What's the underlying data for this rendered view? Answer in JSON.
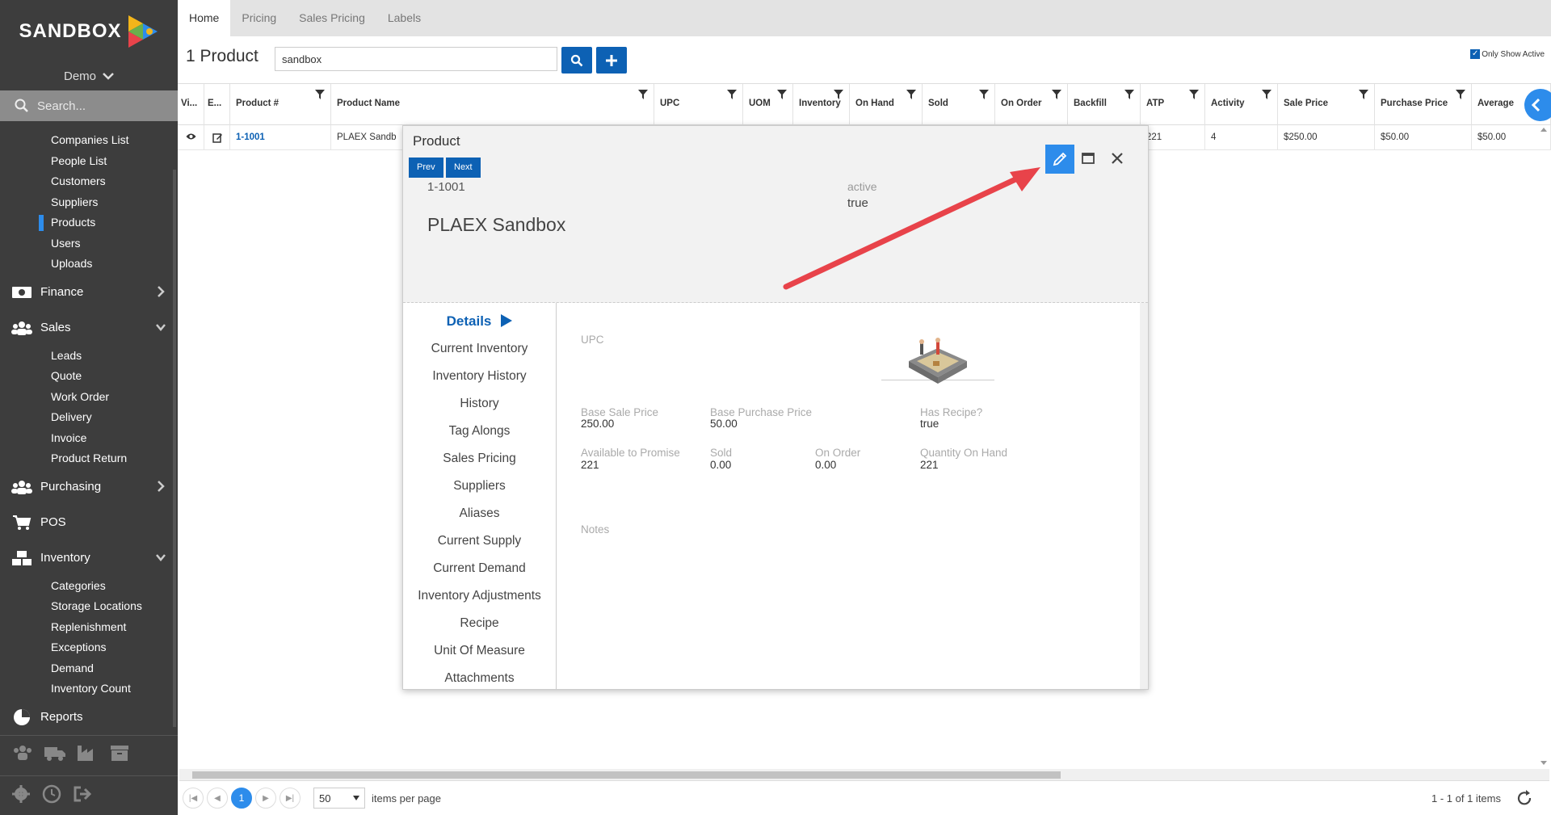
{
  "app": {
    "brand": "SANDBOX",
    "user": "Demo",
    "search_placeholder": "Search..."
  },
  "sidebar": {
    "companies_items": [
      "Companies List",
      "People List",
      "Customers",
      "Suppliers",
      "Products",
      "Users",
      "Uploads"
    ],
    "active_item": "Products",
    "finance": "Finance",
    "sales": "Sales",
    "sales_items": [
      "Leads",
      "Quote",
      "Work Order",
      "Delivery",
      "Invoice",
      "Product Return"
    ],
    "purchasing": "Purchasing",
    "pos": "POS",
    "inventory": "Inventory",
    "inventory_items": [
      "Categories",
      "Storage Locations",
      "Replenishment",
      "Exceptions",
      "Demand",
      "Inventory Count"
    ],
    "reports": "Reports"
  },
  "tabs": [
    "Home",
    "Pricing",
    "Sales Pricing",
    "Labels"
  ],
  "header": {
    "title": "1 Product",
    "search_value": "sandbox",
    "only_show_active": "Only Show Active"
  },
  "grid": {
    "columns": [
      "Vi...",
      "E...",
      "Product #",
      "Product Name",
      "UPC",
      "UOM",
      "Inventory",
      "On Hand",
      "Sold",
      "On Order",
      "Backfill",
      "ATP",
      "Activity",
      "Sale Price",
      "Purchase Price",
      "Average"
    ],
    "row": {
      "product_num": "1-1001",
      "product_name": "PLAEX Sandb",
      "atp": "221",
      "activity": "4",
      "sale_price": "$250.00",
      "purchase_price": "$50.00",
      "average": "$50.00"
    }
  },
  "modal": {
    "title": "Product",
    "prev": "Prev",
    "next": "Next",
    "product_num": "1-1001",
    "product_name": "PLAEX Sandbox",
    "active_label": "active",
    "active_value": "true",
    "menu": [
      "Details",
      "Current Inventory",
      "Inventory History",
      "History",
      "Tag Alongs",
      "Sales Pricing",
      "Suppliers",
      "Aliases",
      "Current Supply",
      "Current Demand",
      "Inventory Adjustments",
      "Recipe",
      "Unit Of Measure",
      "Attachments"
    ],
    "details": {
      "upc_label": "UPC",
      "base_sale_price_label": "Base Sale Price",
      "base_sale_price": "250.00",
      "base_purchase_price_label": "Base Purchase Price",
      "base_purchase_price": "50.00",
      "has_recipe_label": "Has Recipe?",
      "has_recipe": "true",
      "atp_label": "Available to Promise",
      "atp": "221",
      "sold_label": "Sold",
      "sold": "0.00",
      "on_order_label": "On Order",
      "on_order": "0.00",
      "qoh_label": "Quantity On Hand",
      "qoh": "221",
      "notes_label": "Notes"
    }
  },
  "pager": {
    "current_page": "1",
    "per_page": "50",
    "per_page_label": "items per page",
    "count": "1 - 1 of 1 items"
  },
  "colors": {
    "accent": "#2d8ceb",
    "primary": "#0d61b4",
    "sidebar": "#3d3d3d",
    "arrow": "#e8434a"
  }
}
